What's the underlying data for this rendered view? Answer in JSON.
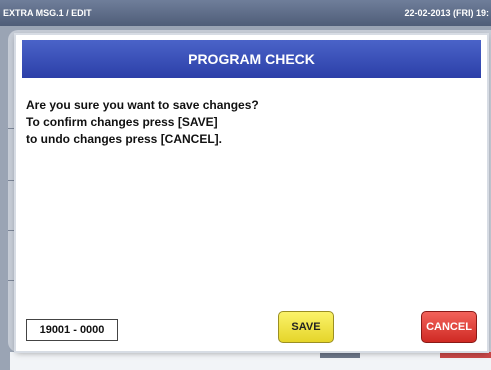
{
  "header": {
    "screen_title": "EXTRA MSG.1 / EDIT",
    "datetime": "22-02-2013 (FRI) 19:"
  },
  "dialog": {
    "title": "PROGRAM CHECK",
    "messages": [
      "Are you sure you want to save changes?",
      "To confirm changes press [SAVE]",
      "to undo changes press [CANCEL]."
    ],
    "code": "19001 - 0000",
    "save_label": "SAVE",
    "cancel_label": "CANCEL"
  },
  "colors": {
    "title_bar": "#2c3fa8",
    "save_button": "#f0e246",
    "cancel_button": "#e0413a"
  }
}
